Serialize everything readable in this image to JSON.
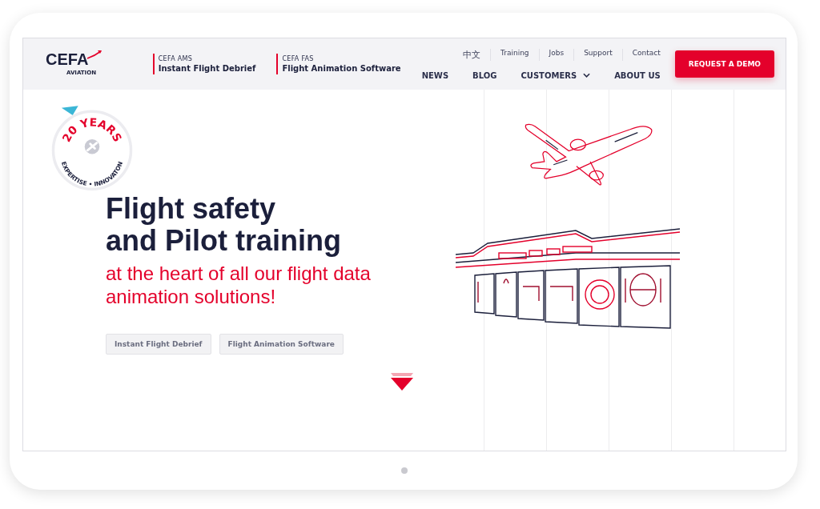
{
  "logo": {
    "name": "CEFA",
    "tagline": "AVIATION"
  },
  "products": [
    {
      "code": "CEFA AMS",
      "name": "Instant Flight Debrief"
    },
    {
      "code": "CEFA FAS",
      "name": "Flight Animation Software"
    }
  ],
  "top_links": [
    "中文",
    "Training",
    "Jobs",
    "Support",
    "Contact"
  ],
  "main_nav": [
    {
      "label": "NEWS",
      "dropdown": false
    },
    {
      "label": "BLOG",
      "dropdown": false
    },
    {
      "label": "CUSTOMERS",
      "dropdown": true
    },
    {
      "label": "ABOUT US",
      "dropdown": false
    }
  ],
  "cta": "REQUEST A DEMO",
  "badge": {
    "top": "20 YEARS",
    "bottom": "EXPERTISE • INNOVATON"
  },
  "hero": {
    "title_lines": [
      "Flight safety",
      "and Pilot training"
    ],
    "subtitle": "at the heart of all our flight data animation solutions!",
    "buttons": [
      "Instant Flight Debrief",
      "Flight Animation Software"
    ]
  }
}
